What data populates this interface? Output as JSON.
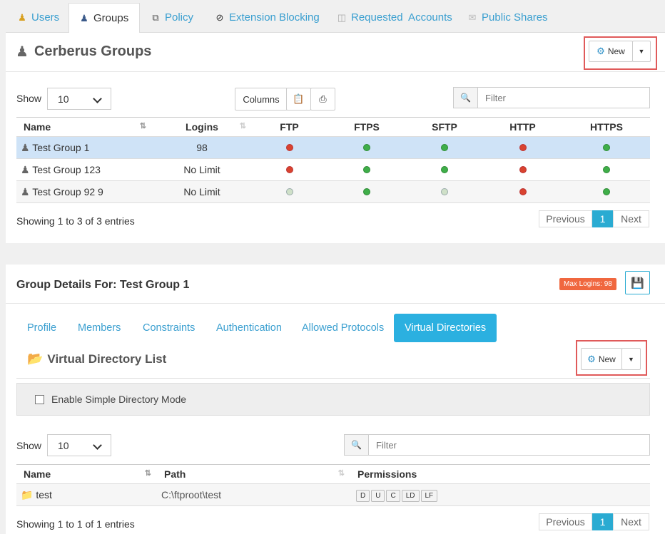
{
  "top_tabs": [
    {
      "label": "Users",
      "icon": "user-icon"
    },
    {
      "label": "Groups",
      "icon": "group-icon"
    },
    {
      "label": "Policy",
      "icon": "policy-icon"
    },
    {
      "label": "Extension Blocking",
      "icon": "block-icon"
    },
    {
      "label": "Requested  Accounts",
      "icon": "inbox-icon"
    },
    {
      "label": "Public Shares",
      "icon": "envelope-icon"
    }
  ],
  "groups_panel": {
    "title": "Cerberus Groups",
    "new_label": "New",
    "show_label": "Show",
    "page_size": "10",
    "columns_label": "Columns",
    "filter_placeholder": "Filter",
    "headers": [
      "Name",
      "Logins",
      "FTP",
      "FTPS",
      "SFTP",
      "HTTP",
      "HTTPS"
    ],
    "rows": [
      {
        "name": "Test Group 1",
        "logins": "98",
        "ftp": "red",
        "ftps": "green",
        "sftp": "green",
        "http": "red",
        "https": "green"
      },
      {
        "name": "Test Group 123",
        "logins": "No Limit",
        "ftp": "red",
        "ftps": "green",
        "sftp": "green",
        "http": "red",
        "https": "green"
      },
      {
        "name": "Test Group 92 9",
        "logins": "No Limit",
        "ftp": "gray",
        "ftps": "green",
        "sftp": "gray",
        "http": "red",
        "https": "green"
      }
    ],
    "info": "Showing 1 to 3 of 3 entries",
    "prev": "Previous",
    "page": "1",
    "next": "Next"
  },
  "details_panel": {
    "title": "Group Details For: Test Group 1",
    "badge": "Max Logins: 98",
    "sub_tabs": [
      "Profile",
      "Members",
      "Constraints",
      "Authentication",
      "Allowed Protocols",
      "Virtual Directories"
    ],
    "vd_title": "Virtual Directory List",
    "new_label": "New",
    "simple_mode_label": "Enable Simple Directory Mode",
    "show_label": "Show",
    "page_size": "10",
    "filter_placeholder": "Filter",
    "headers": [
      "Name",
      "Path",
      "Permissions"
    ],
    "rows": [
      {
        "name": "test",
        "path": "C:\\ftproot\\test",
        "perms": [
          "D",
          "U",
          "C",
          "LD",
          "LF"
        ]
      }
    ],
    "info": "Showing 1 to 1 of 1 entries",
    "prev": "Previous",
    "page": "1",
    "next": "Next"
  },
  "colors": {
    "accent": "#2aabd2",
    "link": "#3a9fd0",
    "red_highlight": "#e05a5a",
    "badge": "#f0673f",
    "selected_row": "#cfe3f7"
  }
}
